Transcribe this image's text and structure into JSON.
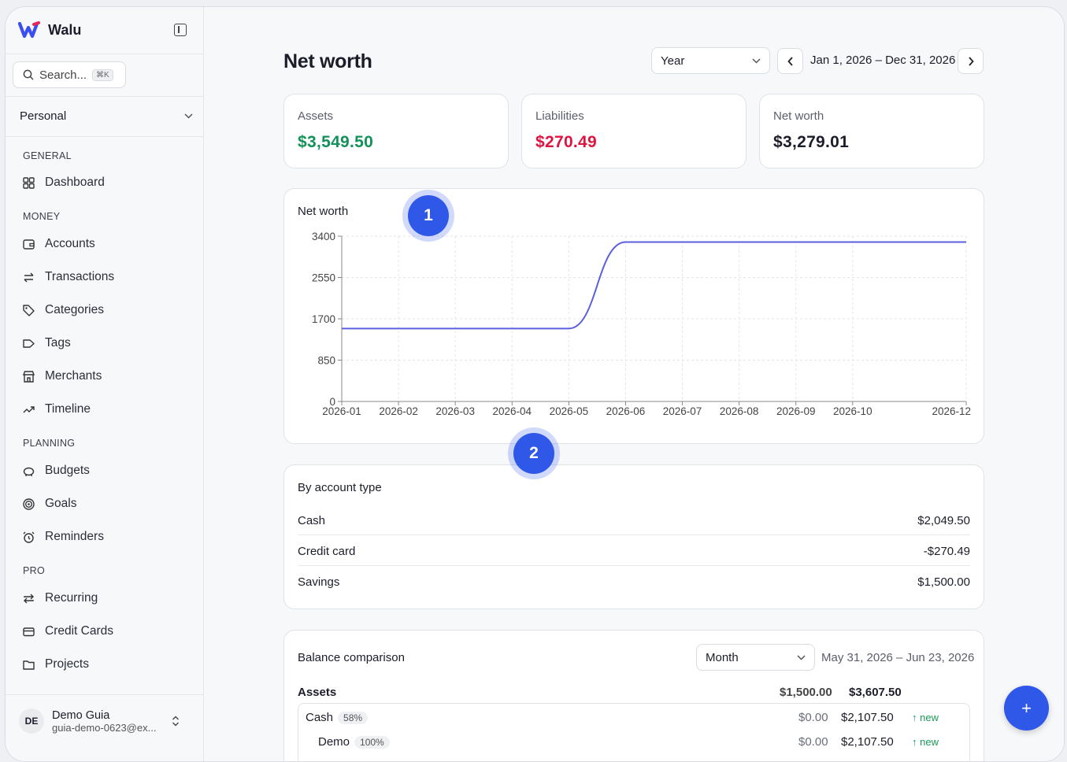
{
  "app": {
    "name": "Walu"
  },
  "search": {
    "placeholder": "Search...",
    "shortcut": "⌘K"
  },
  "workspace": {
    "label": "Personal"
  },
  "sidebar": {
    "sections": [
      {
        "title": "GENERAL",
        "items": [
          {
            "label": "Dashboard",
            "icon": "dashboard-icon"
          }
        ]
      },
      {
        "title": "MONEY",
        "items": [
          {
            "label": "Accounts",
            "icon": "wallet-icon"
          },
          {
            "label": "Transactions",
            "icon": "arrows-icon"
          },
          {
            "label": "Categories",
            "icon": "tag-icon"
          },
          {
            "label": "Tags",
            "icon": "label-icon"
          },
          {
            "label": "Merchants",
            "icon": "store-icon"
          },
          {
            "label": "Timeline",
            "icon": "trend-icon"
          }
        ]
      },
      {
        "title": "PLANNING",
        "items": [
          {
            "label": "Budgets",
            "icon": "piggy-icon"
          },
          {
            "label": "Goals",
            "icon": "target-icon"
          },
          {
            "label": "Reminders",
            "icon": "alarm-icon"
          }
        ]
      },
      {
        "title": "PRO",
        "items": [
          {
            "label": "Recurring",
            "icon": "repeat-icon"
          },
          {
            "label": "Credit Cards",
            "icon": "card-icon"
          },
          {
            "label": "Projects",
            "icon": "folder-icon"
          }
        ]
      }
    ]
  },
  "user": {
    "initials": "DE",
    "name": "Demo Guia",
    "email": "guia-demo-0623@ex..."
  },
  "header": {
    "title": "Net worth",
    "period": "Year",
    "range": "Jan 1, 2026 – Dec 31, 2026"
  },
  "stats": {
    "assets": {
      "label": "Assets",
      "value": "$3,549.50",
      "color": "#13915a"
    },
    "liabilities": {
      "label": "Liabilities",
      "value": "$270.49",
      "color": "#e0123f"
    },
    "net": {
      "label": "Net worth",
      "value": "$3,279.01",
      "color": "#1b1d2a"
    }
  },
  "chart_data": {
    "type": "line",
    "title": "Net worth",
    "x": [
      "2026-01",
      "2026-02",
      "2026-03",
      "2026-04",
      "2026-05",
      "2026-06",
      "2026-07",
      "2026-08",
      "2026-09",
      "2026-10",
      "2026-12"
    ],
    "series": [
      {
        "values": [
          1500,
          1500,
          1500,
          1500,
          1500,
          3279,
          3279,
          3279,
          3279,
          3279,
          3279
        ]
      }
    ],
    "yticks": [
      0,
      850,
      1700,
      2550,
      3400
    ],
    "ylim": [
      0,
      3400
    ],
    "grid": true,
    "color": "#5b5fe0"
  },
  "markers": [
    "1",
    "2"
  ],
  "by_account_type": {
    "title": "By account type",
    "rows": [
      {
        "label": "Cash",
        "value": "$2,049.50"
      },
      {
        "label": "Credit card",
        "value": "-$270.49"
      },
      {
        "label": "Savings",
        "value": "$1,500.00"
      }
    ]
  },
  "balance_comparison": {
    "title": "Balance comparison",
    "period": "Month",
    "range": "May 31, 2026 – Jun 23, 2026",
    "group": {
      "label": "Assets",
      "prev": "$1,500.00",
      "curr": "$3,607.50"
    },
    "rows": [
      {
        "label": "Cash",
        "pct": "58%",
        "prev": "$0.00",
        "curr": "$2,107.50",
        "change": "new"
      },
      {
        "label": "Demo",
        "pct": "100%",
        "prev": "$0.00",
        "curr": "$2,107.50",
        "change": "new"
      }
    ]
  },
  "fab": {
    "label": "+"
  }
}
